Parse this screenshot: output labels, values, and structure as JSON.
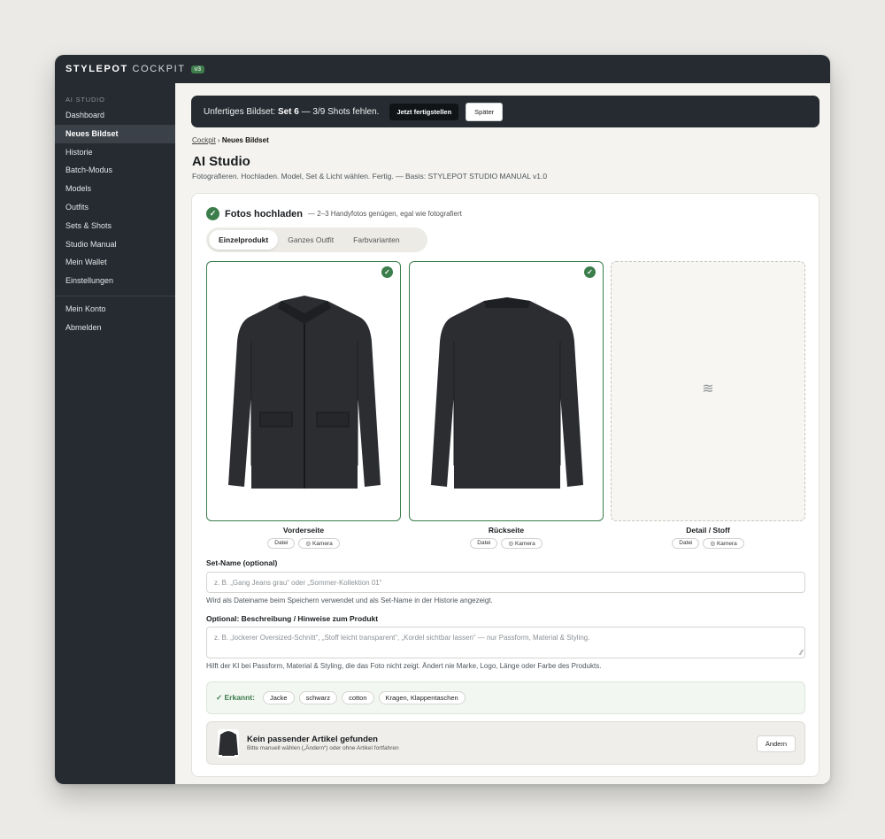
{
  "app": {
    "brand": "STYLEPOT",
    "brand_sub": "COCKPIT",
    "version": "v3"
  },
  "sidebar": {
    "section": "AI STUDIO",
    "items": [
      {
        "label": "Dashboard"
      },
      {
        "label": "Neues Bildset"
      },
      {
        "label": "Historie"
      },
      {
        "label": "Batch-Modus"
      },
      {
        "label": "Models"
      },
      {
        "label": "Outfits"
      },
      {
        "label": "Sets & Shots"
      },
      {
        "label": "Studio Manual"
      },
      {
        "label": "Mein Wallet"
      },
      {
        "label": "Einstellungen"
      }
    ],
    "account_items": [
      {
        "label": "Mein Konto"
      },
      {
        "label": "Abmelden"
      }
    ]
  },
  "banner": {
    "prefix": "Unfertiges Bildset:",
    "set": "Set 6",
    "suffix": "— 3/9 Shots fehlen.",
    "primary": "Jetzt fertigstellen",
    "secondary": "Später"
  },
  "breadcrumb": {
    "root": "Cockpit",
    "sep": "›",
    "current": "Neues Bildset"
  },
  "page": {
    "title": "AI Studio",
    "subtitle": "Fotografieren. Hochladen. Model, Set & Licht wählen. Fertig. — Basis: STYLEPOT STUDIO MANUAL v1.0"
  },
  "upload": {
    "title": "Fotos hochladen",
    "hint": "— 2–3 Handyfotos genügen, egal wie fotografiert",
    "tabs": [
      {
        "label": "Einzelprodukt"
      },
      {
        "label": "Ganzes Outfit"
      },
      {
        "label": "Farbvarianten"
      }
    ],
    "slots": [
      {
        "label": "Vorderseite",
        "file": "Datei",
        "camera": "Kamera"
      },
      {
        "label": "Rückseite",
        "file": "Datei",
        "camera": "Kamera"
      },
      {
        "label": "Detail / Stoff",
        "file": "Datei",
        "camera": "Kamera"
      }
    ]
  },
  "setname": {
    "label": "Set-Name (optional)",
    "placeholder": "z. B. „Gang Jeans grau“ oder „Sommer-Kollektion 01“",
    "help": "Wird als Dateiname beim Speichern verwendet und als Set-Name in der Historie angezeigt."
  },
  "description": {
    "label": "Optional: Beschreibung / Hinweise zum Produkt",
    "placeholder": "z. B. „lockerer Oversized-Schnitt“, „Stoff leicht transparent“, „Kordel sichtbar lassen“ — nur Passform, Material & Styling.",
    "help": "Hilft der KI bei Passform, Material & Styling, die das Foto nicht zeigt. Ändert nie Marke, Logo, Länge oder Farbe des Produkts."
  },
  "recognized": {
    "label": "✓ Erkannt:",
    "chips": [
      "Jacke",
      "schwarz",
      "cotton",
      "Kragen, Klappentaschen"
    ]
  },
  "match": {
    "title": "Kein passender Artikel gefunden",
    "subtitle": "Bitte manuell wählen („Ändern“) oder ohne Artikel fortfahren",
    "button": "Ändern"
  },
  "colors": {
    "accent": "#3b7d4b",
    "sidebar": "#262b31",
    "jacket": "#2b2d31"
  }
}
